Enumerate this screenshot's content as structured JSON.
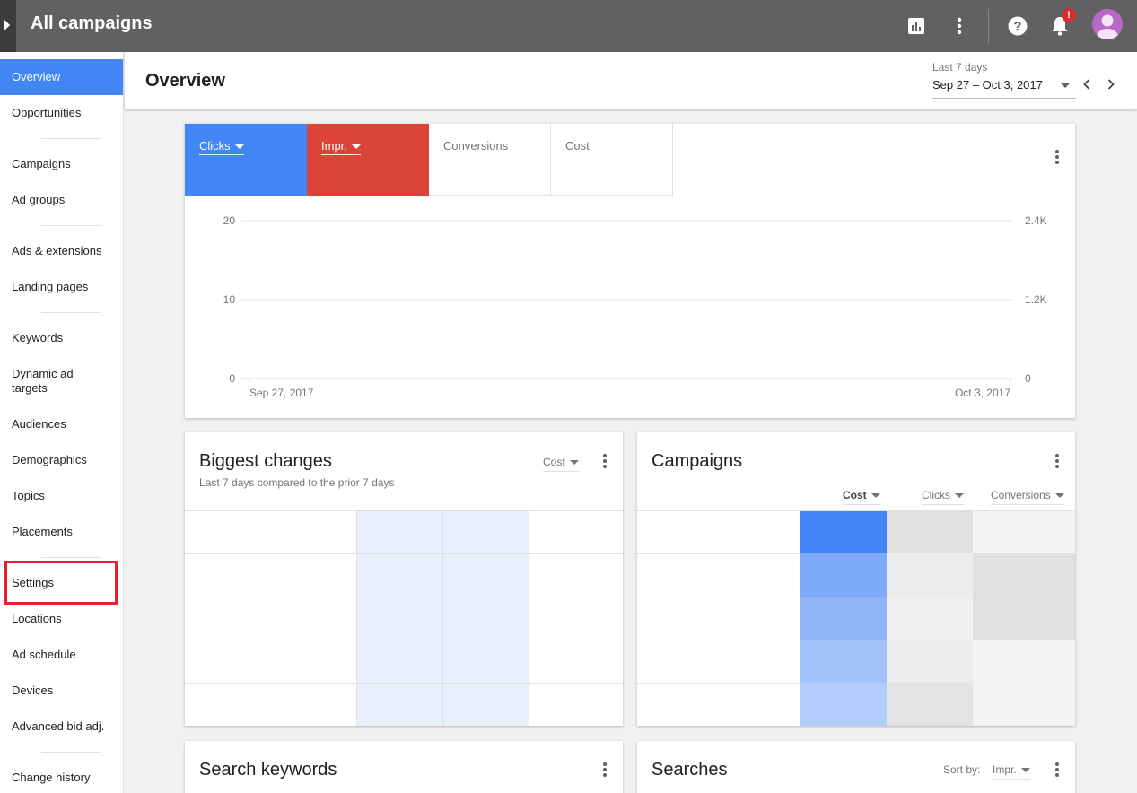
{
  "topbar": {
    "title": "All campaigns",
    "icons": [
      "reports-icon",
      "more-vert-icon",
      "help-icon",
      "notifications-icon",
      "account-avatar"
    ],
    "notification_badge": "!",
    "colors": {
      "bar": "#616161",
      "badge": "#d32f2f",
      "avatar": "#ba68c8"
    }
  },
  "sidebar": {
    "items": [
      {
        "label": "Overview",
        "active": true
      },
      {
        "label": "Opportunities"
      },
      {
        "label": "Campaigns"
      },
      {
        "label": "Ad groups"
      },
      {
        "label": "Ads & extensions"
      },
      {
        "label": "Landing pages"
      },
      {
        "label": "Keywords"
      },
      {
        "label": "Dynamic ad targets"
      },
      {
        "label": "Audiences"
      },
      {
        "label": "Demographics"
      },
      {
        "label": "Topics"
      },
      {
        "label": "Placements"
      },
      {
        "label": "Settings",
        "highlighted": true
      },
      {
        "label": "Locations"
      },
      {
        "label": "Ad schedule"
      },
      {
        "label": "Devices"
      },
      {
        "label": "Advanced bid adj."
      },
      {
        "label": "Change history"
      }
    ],
    "colors": {
      "active": "#4285f4",
      "highlight_box": "#e8202f"
    }
  },
  "header": {
    "title": "Overview",
    "date_range_label": "Last 7 days",
    "date_range_value": "Sep 27 – Oct 3, 2017"
  },
  "overview_card": {
    "metrics": [
      {
        "label": "Clicks",
        "selected": true,
        "color": "#4285f4"
      },
      {
        "label": "Impr.",
        "selected": true,
        "color": "#db4437"
      },
      {
        "label": "Conversions",
        "selected": false
      },
      {
        "label": "Cost",
        "selected": false
      }
    ],
    "chart_data": {
      "type": "line",
      "x": [
        "Sep 27, 2017",
        "Oct 3, 2017"
      ],
      "y_left_ticks": [
        "20",
        "10",
        "0"
      ],
      "y_right_ticks": [
        "2.4K",
        "1.2K",
        "0"
      ],
      "ylim_left": [
        0,
        20
      ],
      "ylim_right": [
        0,
        2400
      ],
      "grid": true,
      "series": []
    }
  },
  "biggest_changes": {
    "title": "Biggest changes",
    "subtitle": "Last 7 days compared to the prior 7 days",
    "sort_label": "Cost"
  },
  "campaigns_card": {
    "title": "Campaigns",
    "columns": [
      "Cost",
      "Clicks",
      "Conversions"
    ]
  },
  "search_keywords": {
    "title": "Search keywords"
  },
  "searches": {
    "title": "Searches",
    "sort_by_label": "Sort by:",
    "sort_value": "Impr."
  }
}
